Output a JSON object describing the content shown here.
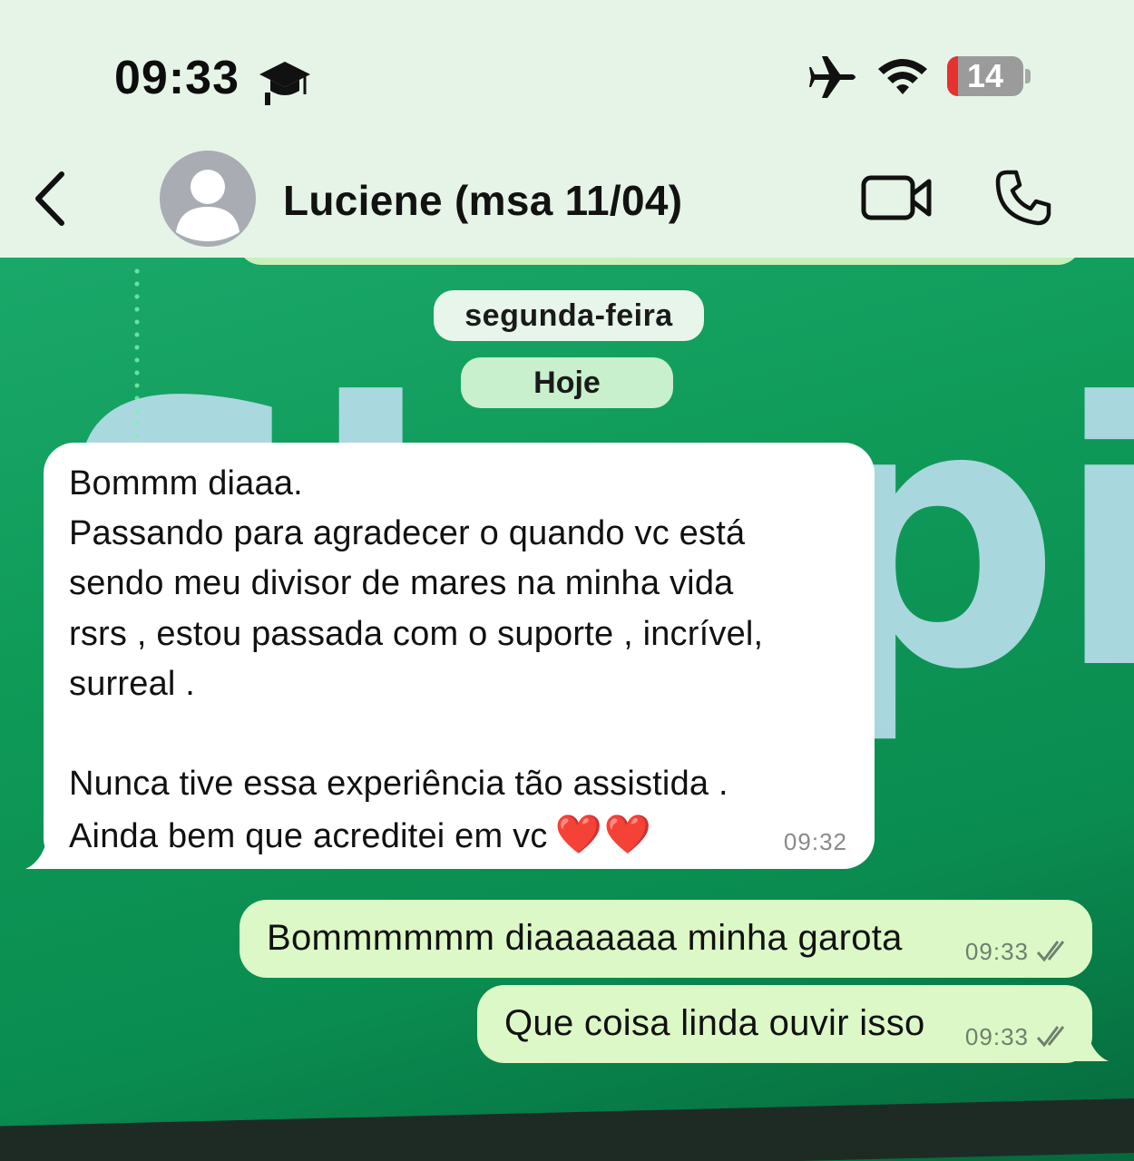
{
  "status_bar": {
    "time": "09:33",
    "battery_level": "14",
    "battery_fraction": 0.14,
    "icons": [
      "graduation-cap-icon",
      "airplane-icon",
      "wifi-icon",
      "battery-icon"
    ]
  },
  "header": {
    "contact_name": "Luciene (msa 11/04)",
    "icons": [
      "back-chevron-icon",
      "avatar-placeholder-icon",
      "video-call-icon",
      "phone-call-icon"
    ]
  },
  "chat": {
    "date_separator": "segunda-feira",
    "today_separator": "Hoje",
    "background_text": "Shopify",
    "incoming": {
      "lines": [
        "Bommm diaaa.",
        "Passando para agradecer o quando vc está",
        "sendo meu divisor de mares na minha vida",
        "rsrs , estou passada com o suporte , incrível,",
        "surreal .",
        "",
        "Nunca tive essa experiência tão assistida .",
        "Ainda bem que acreditei em vc"
      ],
      "emoji": "❤️❤️",
      "time": "09:32"
    },
    "outgoing": [
      {
        "text": "Bommmmmm diaaaaaaa minha garota",
        "time": "09:33",
        "status": "read-double-check"
      },
      {
        "text": "Que coisa linda ouvir isso",
        "time": "09:33",
        "status": "read-double-check"
      }
    ]
  },
  "colors": {
    "header_bg": "#e6f4e8",
    "chat_bg": "#0f9a58",
    "incoming_bubble": "#ffffff",
    "outgoing_bubble": "#dcf8c6",
    "battery_low": "#e5322f"
  }
}
